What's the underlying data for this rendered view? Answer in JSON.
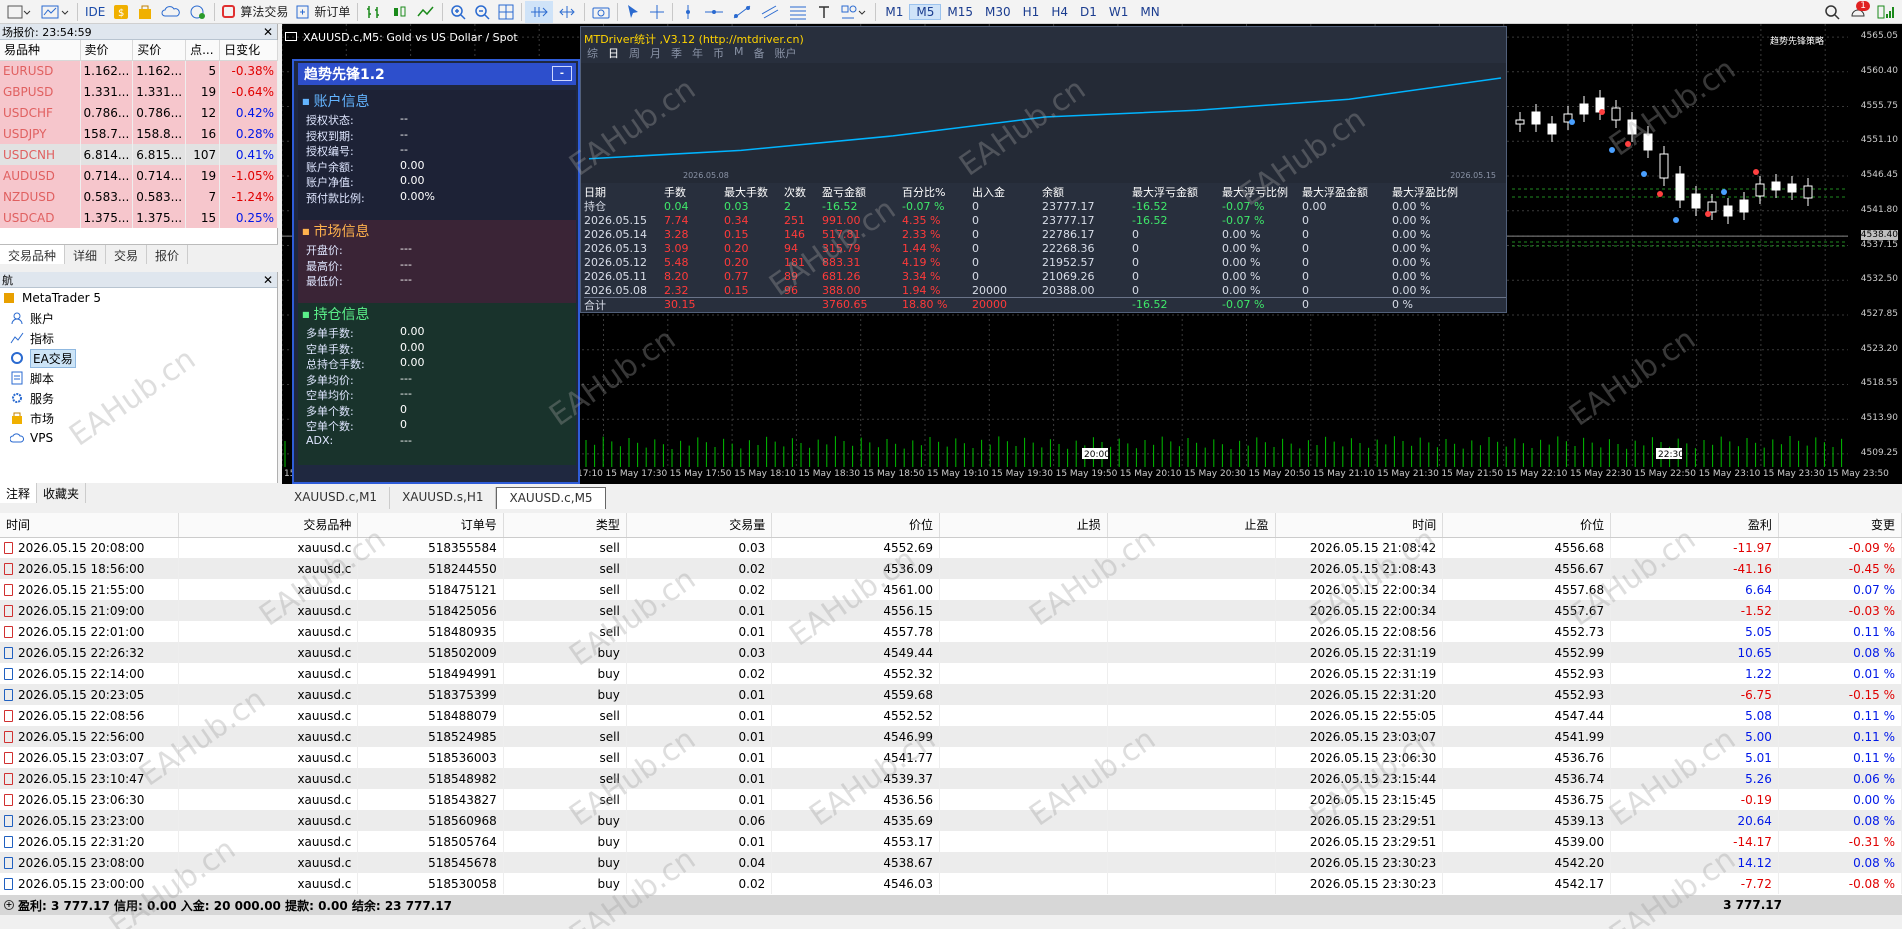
{
  "toolbar": {
    "algo_trading": "算法交易",
    "new_order": "新订单",
    "ide": "IDE",
    "timeframes": [
      "M1",
      "M5",
      "M15",
      "M30",
      "H1",
      "H4",
      "D1",
      "W1",
      "MN"
    ],
    "active_timeframe": "M5",
    "notify_count": "1"
  },
  "quotes": {
    "title": "场报价: 23:54:59",
    "headers": [
      "易品种",
      "卖价",
      "买价",
      "点...",
      "日变化"
    ],
    "rows": [
      {
        "symbol": "EURUSD",
        "bid": "1.162...",
        "ask": "1.162...",
        "spread": "5",
        "change": "-0.38%",
        "dir": "down"
      },
      {
        "symbol": "GBPUSD",
        "bid": "1.331...",
        "ask": "1.331...",
        "spread": "19",
        "change": "-0.64%",
        "dir": "down"
      },
      {
        "symbol": "USDCHF",
        "bid": "0.786...",
        "ask": "0.786...",
        "spread": "12",
        "change": "0.42%",
        "dir": "down"
      },
      {
        "symbol": "USDJPY",
        "bid": "158.7...",
        "ask": "158.8...",
        "spread": "16",
        "change": "0.28%",
        "dir": "down"
      },
      {
        "symbol": "USDCNH",
        "bid": "6.814...",
        "ask": "6.815...",
        "spread": "107",
        "change": "0.41%",
        "dir": "grey"
      },
      {
        "symbol": "AUDUSD",
        "bid": "0.714...",
        "ask": "0.714...",
        "spread": "19",
        "change": "-1.05%",
        "dir": "down"
      },
      {
        "symbol": "NZDUSD",
        "bid": "0.583...",
        "ask": "0.583...",
        "spread": "7",
        "change": "-1.24%",
        "dir": "down"
      },
      {
        "symbol": "USDCAD",
        "bid": "1.375...",
        "ask": "1.375...",
        "spread": "15",
        "change": "0.25%",
        "dir": "down"
      }
    ],
    "tabs": [
      "交易品种",
      "详细",
      "交易",
      "报价"
    ]
  },
  "navigator": {
    "title": "航",
    "root": "MetaTrader 5",
    "items": [
      "账户",
      "指标",
      "EA交易",
      "脚本",
      "服务",
      "市场",
      "VPS"
    ],
    "tabs": [
      "注释",
      "收藏夹"
    ]
  },
  "chart": {
    "title": "XAUUSD.c,M5:  Gold vs US Dollar / Spot",
    "corner_label": "趋势先锋策略",
    "price_labels": [
      "4565.05",
      "4560.40",
      "4555.75",
      "4551.10",
      "4546.45",
      "4541.80",
      "4538.40",
      "4537.15",
      "4532.50",
      "4527.85",
      "4523.20",
      "4518.55",
      "4513.90",
      "4509.25"
    ],
    "time_labels": [
      "15 May 2026",
      "15 May 16:10",
      "15 May 16:30",
      "15 May 16:50",
      "15 May 17:10",
      "15 May 17:30",
      "15 May 17:50",
      "15 May 18:10",
      "15 May 18:30",
      "15 May 18:50",
      "15 May 19:10",
      "15 May 19:30",
      "15 May 19:50",
      "15 May 20:10",
      "15 May 20:30",
      "15 May 20:50",
      "15 May 21:10",
      "15 May 21:30",
      "15 May 21:50",
      "15 May 22:10",
      "15 May 22:30",
      "15 May 22:50",
      "15 May 23:10",
      "15 May 23:30",
      "15 May 23:50"
    ],
    "vol_marks": [
      "20:00",
      "22:30"
    ],
    "tabs": [
      "XAUUSD.c,M1",
      "XAUUSD.s,H1",
      "XAUUSD.c,M5"
    ]
  },
  "ea": {
    "title": "趋势先锋1.2",
    "min": "-",
    "account": {
      "header": "账户信息",
      "rows": [
        [
          "授权状态:",
          "--"
        ],
        [
          "授权到期:",
          "--"
        ],
        [
          "授权编号:",
          "--"
        ],
        [
          "账户余额:",
          "0.00"
        ],
        [
          "账户净值:",
          "0.00"
        ],
        [
          "预付款比例:",
          "0.00%"
        ]
      ]
    },
    "market": {
      "header": "市场信息",
      "rows": [
        [
          "开盘价:",
          "---"
        ],
        [
          "最高价:",
          "---"
        ],
        [
          "最低价:",
          "---"
        ]
      ]
    },
    "position": {
      "header": "持仓信息",
      "rows": [
        [
          "多单手数:",
          "0.00"
        ],
        [
          "空单手数:",
          "0.00"
        ],
        [
          "总持仓手数:",
          "0.00"
        ],
        [
          "多单均价:",
          "---"
        ],
        [
          "空单均价:",
          "---"
        ],
        [
          "多单个数:",
          "0"
        ],
        [
          "空单个数:",
          "0"
        ],
        [
          "ADX:",
          "---"
        ]
      ]
    }
  },
  "mtdriver": {
    "title": "MTDriver统计 ,V3.12 (http://mtdriver.cn)",
    "tabs": [
      "综",
      "日",
      "周",
      "月",
      "季",
      "年",
      "币",
      "M",
      "备",
      "账户"
    ],
    "date_start": "2026.05.08",
    "date_end": "2026.05.15",
    "headers": [
      "日期",
      "手数",
      "最大手数",
      "次数",
      "盈亏金额",
      "百分比%",
      "出入金",
      "余额",
      "最大浮亏金额",
      "最大浮亏比例",
      "最大浮盈金额",
      "最大浮盈比例"
    ],
    "rows": [
      [
        "持仓",
        "0.04",
        "0.03",
        "2",
        "-16.52",
        "-0.07 %",
        "0",
        "23777.17",
        "-16.52",
        "-0.07 %",
        "0.00",
        "0.00 %"
      ],
      [
        "2026.05.15",
        "7.74",
        "0.34",
        "251",
        "991.00",
        "4.35 %",
        "0",
        "23777.17",
        "-16.52",
        "-0.07 %",
        "0",
        "0.00 %"
      ],
      [
        "2026.05.14",
        "3.28",
        "0.15",
        "146",
        "517.81",
        "2.33 %",
        "0",
        "22786.17",
        "0",
        "0.00 %",
        "0",
        "0.00 %"
      ],
      [
        "2026.05.13",
        "3.09",
        "0.20",
        "94",
        "315.79",
        "1.44 %",
        "0",
        "22268.36",
        "0",
        "0.00 %",
        "0",
        "0.00 %"
      ],
      [
        "2026.05.12",
        "5.48",
        "0.20",
        "181",
        "883.31",
        "4.19 %",
        "0",
        "21952.57",
        "0",
        "0.00 %",
        "0",
        "0.00 %"
      ],
      [
        "2026.05.11",
        "8.20",
        "0.77",
        "89",
        "681.26",
        "3.34 %",
        "0",
        "21069.26",
        "0",
        "0.00 %",
        "0",
        "0.00 %"
      ],
      [
        "2026.05.08",
        "2.32",
        "0.15",
        "96",
        "388.00",
        "1.94 %",
        "20000",
        "20388.00",
        "0",
        "0.00 %",
        "0",
        "0.00 %"
      ],
      [
        "合计",
        "30.15",
        "",
        "",
        "3760.65",
        "18.80 %",
        "20000",
        "",
        "-16.52",
        "-0.07 %",
        "0",
        "0 %"
      ]
    ]
  },
  "trades": {
    "headers": [
      "时间",
      "交易品种",
      "订单号",
      "类型",
      "交易量",
      "价位",
      "止损",
      "止盈",
      "时间",
      "价位",
      "盈利",
      "变更"
    ],
    "rows": [
      [
        "2026.05.15 20:08:00",
        "xauusd.c",
        "518355584",
        "sell",
        "0.03",
        "4552.69",
        "",
        "",
        "2026.05.15 21:08:42",
        "4556.68",
        "-11.97",
        "-0.09 %"
      ],
      [
        "2026.05.15 18:56:00",
        "xauusd.c",
        "518244550",
        "sell",
        "0.02",
        "4536.09",
        "",
        "",
        "2026.05.15 21:08:43",
        "4556.67",
        "-41.16",
        "-0.45 %"
      ],
      [
        "2026.05.15 21:55:00",
        "xauusd.c",
        "518475121",
        "sell",
        "0.02",
        "4561.00",
        "",
        "",
        "2026.05.15 22:00:34",
        "4557.68",
        "6.64",
        "0.07 %"
      ],
      [
        "2026.05.15 21:09:00",
        "xauusd.c",
        "518425056",
        "sell",
        "0.01",
        "4556.15",
        "",
        "",
        "2026.05.15 22:00:34",
        "4557.67",
        "-1.52",
        "-0.03 %"
      ],
      [
        "2026.05.15 22:01:00",
        "xauusd.c",
        "518480935",
        "sell",
        "0.01",
        "4557.78",
        "",
        "",
        "2026.05.15 22:08:56",
        "4552.73",
        "5.05",
        "0.11 %"
      ],
      [
        "2026.05.15 22:26:32",
        "xauusd.c",
        "518502009",
        "buy",
        "0.03",
        "4549.44",
        "",
        "",
        "2026.05.15 22:31:19",
        "4552.99",
        "10.65",
        "0.08 %"
      ],
      [
        "2026.05.15 22:14:00",
        "xauusd.c",
        "518494991",
        "buy",
        "0.02",
        "4552.32",
        "",
        "",
        "2026.05.15 22:31:19",
        "4552.93",
        "1.22",
        "0.01 %"
      ],
      [
        "2026.05.15 20:23:05",
        "xauusd.c",
        "518375399",
        "buy",
        "0.01",
        "4559.68",
        "",
        "",
        "2026.05.15 22:31:20",
        "4552.93",
        "-6.75",
        "-0.15 %"
      ],
      [
        "2026.05.15 22:08:56",
        "xauusd.c",
        "518488079",
        "sell",
        "0.01",
        "4552.52",
        "",
        "",
        "2026.05.15 22:55:05",
        "4547.44",
        "5.08",
        "0.11 %"
      ],
      [
        "2026.05.15 22:56:00",
        "xauusd.c",
        "518524985",
        "sell",
        "0.01",
        "4546.99",
        "",
        "",
        "2026.05.15 23:03:07",
        "4541.99",
        "5.00",
        "0.11 %"
      ],
      [
        "2026.05.15 23:03:07",
        "xauusd.c",
        "518536003",
        "sell",
        "0.01",
        "4541.77",
        "",
        "",
        "2026.05.15 23:06:30",
        "4536.76",
        "5.01",
        "0.11 %"
      ],
      [
        "2026.05.15 23:10:47",
        "xauusd.c",
        "518548982",
        "sell",
        "0.01",
        "4539.37",
        "",
        "",
        "2026.05.15 23:15:44",
        "4536.74",
        "5.26",
        "0.06 %"
      ],
      [
        "2026.05.15 23:06:30",
        "xauusd.c",
        "518543827",
        "sell",
        "0.01",
        "4536.56",
        "",
        "",
        "2026.05.15 23:15:45",
        "4536.75",
        "-0.19",
        "0.00 %"
      ],
      [
        "2026.05.15 23:23:00",
        "xauusd.c",
        "518560968",
        "buy",
        "0.06",
        "4535.69",
        "",
        "",
        "2026.05.15 23:29:51",
        "4539.13",
        "20.64",
        "0.08 %"
      ],
      [
        "2026.05.15 22:31:20",
        "xauusd.c",
        "518505764",
        "buy",
        "0.01",
        "4553.17",
        "",
        "",
        "2026.05.15 23:29:51",
        "4539.00",
        "-14.17",
        "-0.31 %"
      ],
      [
        "2026.05.15 23:08:00",
        "xauusd.c",
        "518545678",
        "buy",
        "0.04",
        "4538.67",
        "",
        "",
        "2026.05.15 23:30:23",
        "4542.20",
        "14.12",
        "0.08 %"
      ],
      [
        "2026.05.15 23:00:00",
        "xauusd.c",
        "518530058",
        "buy",
        "0.02",
        "4546.03",
        "",
        "",
        "2026.05.15 23:30:23",
        "4542.17",
        "-7.72",
        "-0.08 %"
      ]
    ],
    "summary": "盈利: 3 777.17  信用: 0.00  入金: 20 000.00  提款: 0.00  结余: 23 777.17",
    "total": "3 777.17"
  },
  "watermark": "EAHub.cn",
  "colors": {
    "neg": "#e00000",
    "pos": "#0018e8",
    "bull": "#00c000",
    "line": "#00b4ff"
  }
}
